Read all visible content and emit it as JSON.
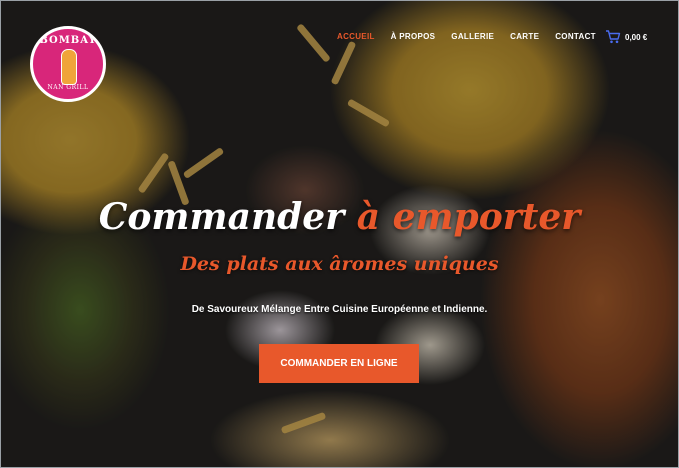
{
  "logo": {
    "top_text": "BOMBAY",
    "bottom_text": "NAN GRILL"
  },
  "nav": {
    "items": [
      {
        "label": "ACCUEIL",
        "active": true
      },
      {
        "label": "À PROPOS",
        "active": false
      },
      {
        "label": "GALLERIE",
        "active": false
      },
      {
        "label": "CARTE",
        "active": false
      },
      {
        "label": "CONTACT",
        "active": false
      }
    ],
    "cart_icon": "shopping-cart-icon",
    "cart_amount": "0,00 €"
  },
  "hero": {
    "headline_main": "Commander",
    "headline_accent": "à emporter",
    "subheadline": "Des plats aux âromes uniques",
    "description": "De Savoureux Mélange Entre Cuisine Européenne et Indienne.",
    "cta_label": "COMMANDER EN LIGNE"
  },
  "colors": {
    "accent": "#e8582b",
    "logo_bg": "#d8267a",
    "text": "#ffffff",
    "cart_icon": "#4a6cf0"
  }
}
